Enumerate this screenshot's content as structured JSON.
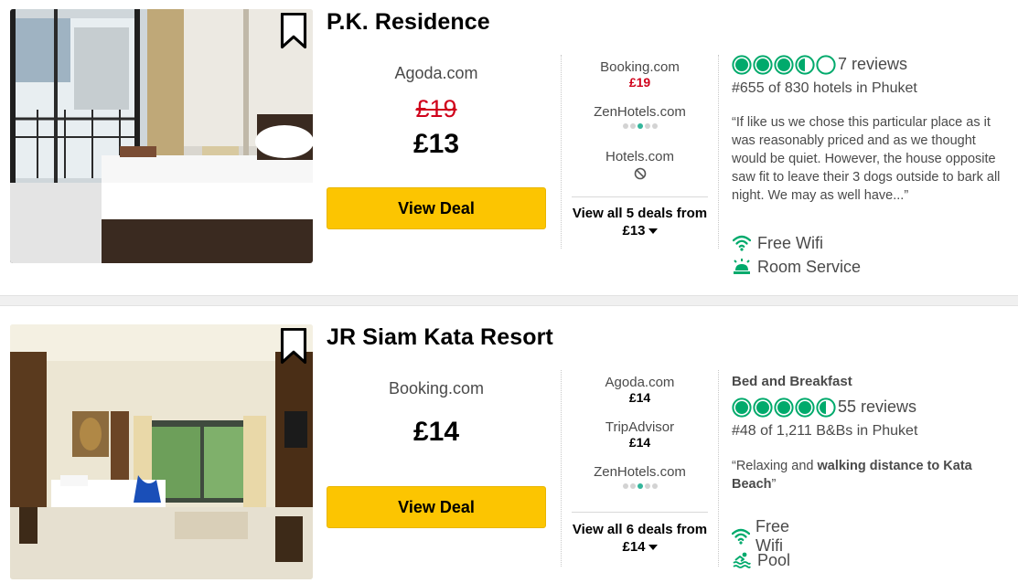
{
  "hotels": [
    {
      "name": "P.K. Residence",
      "main_provider": "Agoda.com",
      "original_price": "£19",
      "price": "£13",
      "view_deal_label": "View Deal",
      "alt_deals": [
        {
          "provider": "Booking.com",
          "price": "£19",
          "price_color": "#d0021b"
        },
        {
          "provider": "ZenHotels.com",
          "status": "loading"
        },
        {
          "provider": "Hotels.com",
          "status": "unavailable"
        }
      ],
      "view_all_text": "View all 5 deals from",
      "view_all_price": "£13",
      "rating": 3.5,
      "reviews": "7 reviews",
      "ranking": "#655 of 830 hotels in Phuket",
      "quote": "“If like us we chose this particular place as it was reasonably priced and as we thought would be quiet. However, the house opposite saw fit to leave their 3 dogs outside to bark all night. We may as well have...”",
      "amenities": [
        {
          "icon": "wifi-icon",
          "label": "Free Wifi"
        },
        {
          "icon": "room-service-icon",
          "label": "Room Service"
        }
      ]
    },
    {
      "name": "JR Siam Kata Resort",
      "main_provider": "Booking.com",
      "price": "£14",
      "view_deal_label": "View Deal",
      "alt_deals": [
        {
          "provider": "Agoda.com",
          "price": "£14"
        },
        {
          "provider": "TripAdvisor",
          "price": "£14"
        },
        {
          "provider": "ZenHotels.com",
          "status": "loading"
        }
      ],
      "view_all_text": "View all 6 deals from",
      "view_all_price": "£14",
      "category": "Bed and Breakfast",
      "rating": 4.5,
      "reviews": "55 reviews",
      "ranking": "#48 of 1,211 B&Bs in Phuket",
      "quote_parts": {
        "open": "“Relaxing and ",
        "bold": "walking distance to Kata Beach",
        "close": "”"
      },
      "amenities": [
        {
          "icon": "wifi-icon",
          "label": "Free Wifi"
        },
        {
          "icon": "pool-icon",
          "label": "Pool"
        }
      ]
    }
  ],
  "colors": {
    "accent_green": "#00aa6c",
    "deal_yellow": "#fcc501",
    "sale_red": "#d0021b"
  }
}
